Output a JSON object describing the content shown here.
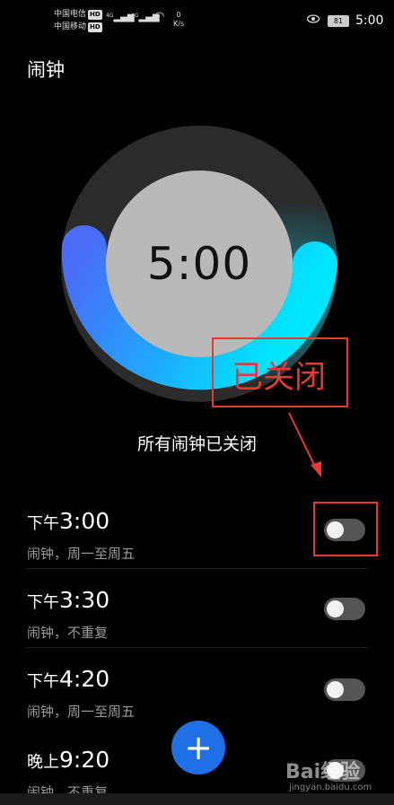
{
  "status": {
    "carrier1": "中国电信",
    "carrier2": "中国移动",
    "hd": "HD",
    "net1": "4G",
    "net2": "4G",
    "speed_value": "0",
    "speed_unit": "K/s",
    "battery": "81",
    "time": "5:00"
  },
  "page": {
    "title": "闹钟"
  },
  "dial": {
    "time": "5:00"
  },
  "annotation": {
    "text": "已关闭"
  },
  "summary": "所有闹钟已关闭",
  "alarms": [
    {
      "prefix": "下午",
      "time": "3:00",
      "desc": "闹钟，周一至周五",
      "enabled": false
    },
    {
      "prefix": "下午",
      "time": "3:30",
      "desc": "闹钟，不重复",
      "enabled": false
    },
    {
      "prefix": "下午",
      "time": "4:20",
      "desc": "闹钟，周一至周五",
      "enabled": false
    },
    {
      "prefix": "晚上",
      "time": "9:20",
      "desc": "闹钟，不重复",
      "enabled": false
    }
  ],
  "fab": {
    "icon": "plus-icon",
    "label": "+"
  },
  "watermark": {
    "brand": "Bai经验",
    "url": "jingyan.baidu.com"
  },
  "colors": {
    "accent": "#1f6fe6",
    "annotation": "#e53935",
    "dial_blue": "#4a6cf7",
    "dial_cyan": "#00e5ff"
  }
}
